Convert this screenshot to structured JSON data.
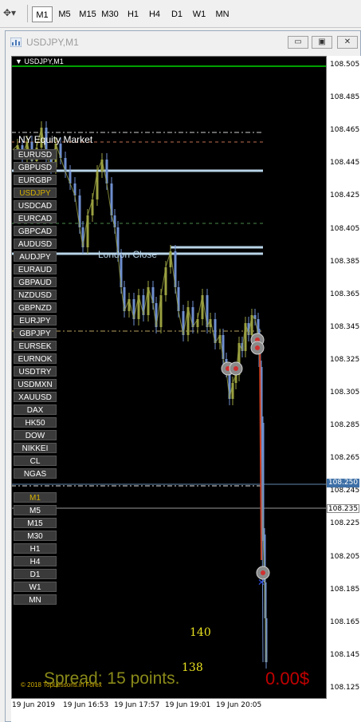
{
  "toolbar": {
    "timeframes": [
      "M1",
      "M5",
      "M15",
      "M30",
      "H1",
      "H4",
      "D1",
      "W1",
      "MN"
    ],
    "active_timeframe": "M1"
  },
  "window": {
    "title": "USDJPY,M1"
  },
  "chart": {
    "symbol_label": "USDJPY,M1",
    "price_ticks": [
      "108.505",
      "108.485",
      "108.465",
      "108.445",
      "108.425",
      "108.405",
      "108.385",
      "108.365",
      "108.345",
      "108.325",
      "108.305",
      "108.285",
      "108.265",
      "108.245",
      "108.225",
      "108.205",
      "108.185",
      "108.165",
      "108.145",
      "108.125"
    ],
    "time_ticks": [
      "19 Jun 2019",
      "19 Jun 16:53",
      "19 Jun 17:57",
      "19 Jun 19:01",
      "19 Jun 20:05"
    ],
    "badge_price_1": "108.250",
    "badge_price_2": "108.235",
    "market_label": "NY Equity Market",
    "london_label": "London Close",
    "count_1": "140",
    "count_2": "138",
    "spread_text": "Spread: 15 points.",
    "profit_text": "0.00$",
    "copyright": "© 2018 TopLessons.in Forex",
    "symbols": [
      "EURUSD",
      "GBPUSD",
      "EURGBP",
      "USDJPY",
      "USDCAD",
      "EURCAD",
      "GBPCAD",
      "AUDUSD",
      "AUDJPY",
      "EURAUD",
      "GBPAUD",
      "NZDUSD",
      "GBPNZD",
      "EURJPY",
      "GBPJPY",
      "EURSEK",
      "EURNOK",
      "USDTRY",
      "USDMXN",
      "XAUUSD",
      "DAX",
      "HK50",
      "DOW",
      "NIKKEI",
      "CL",
      "NGAS"
    ],
    "selected_symbol": "USDJPY",
    "tf_buttons": [
      "M1",
      "M5",
      "M15",
      "M30",
      "H1",
      "H4",
      "D1",
      "W1",
      "MN"
    ],
    "selected_tf": "M1",
    "colors": {
      "background": "#000000",
      "bull": "#9aa040",
      "bear": "#6f8fcf",
      "level_line": "#b8d4e8",
      "spread_color": "#8a8a1a",
      "profit_color": "#c00000",
      "counter_color": "#e8e020",
      "top_line": "#00a000"
    }
  }
}
